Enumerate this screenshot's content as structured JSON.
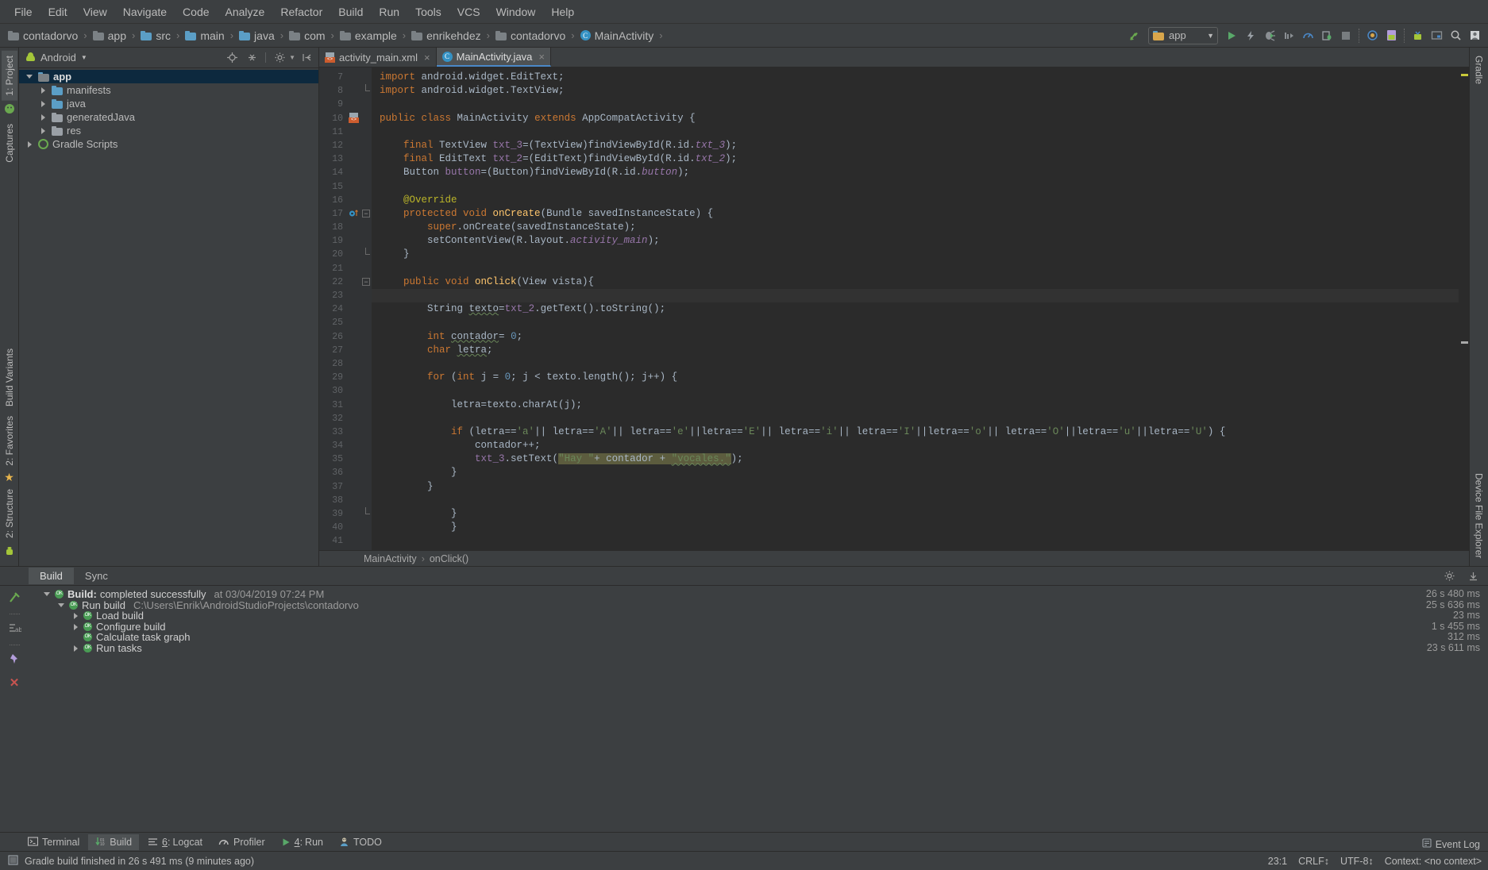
{
  "menubar": {
    "items": [
      "File",
      "Edit",
      "View",
      "Navigate",
      "Code",
      "Analyze",
      "Refactor",
      "Build",
      "Run",
      "Tools",
      "VCS",
      "Window",
      "Help"
    ]
  },
  "navbar": {
    "breadcrumbs": [
      {
        "label": "contadorvo",
        "icon": "project-folder-icon"
      },
      {
        "label": "app",
        "icon": "module-folder-icon"
      },
      {
        "label": "src",
        "icon": "folder-icon"
      },
      {
        "label": "main",
        "icon": "folder-icon"
      },
      {
        "label": "java",
        "icon": "source-folder-icon"
      },
      {
        "label": "com",
        "icon": "package-folder-icon"
      },
      {
        "label": "example",
        "icon": "package-folder-icon"
      },
      {
        "label": "enrikehdez",
        "icon": "package-folder-icon"
      },
      {
        "label": "contadorvo",
        "icon": "package-folder-icon"
      },
      {
        "label": "MainActivity",
        "icon": "java-class-icon"
      }
    ],
    "separator": "›",
    "module_selector": "app",
    "toolbar_icons": [
      "sync-project-icon",
      "run-icon",
      "apply-changes-icon",
      "debug-icon",
      "run-coverage-icon",
      "profiler-icon",
      "attach-debugger-icon",
      "stop-icon",
      "sdk-manager-icon",
      "avd-manager-icon",
      "device-manager-icon",
      "layout-inspector-icon",
      "search-icon",
      "profile-icon"
    ]
  },
  "left_tool_strip": {
    "tabs": [
      "1: Project",
      "Captures"
    ],
    "bottom_tabs": [
      "Build Variants",
      "2: Favorites",
      "2: Structure"
    ]
  },
  "project_panel": {
    "view_selector": "Android",
    "header_icons": [
      "locate-icon",
      "collapse-all-icon",
      "settings-icon",
      "hide-icon"
    ],
    "tree": [
      {
        "label": "app",
        "depth": 0,
        "state": "open",
        "icon": "module-folder-icon",
        "selected": true,
        "bold": true
      },
      {
        "label": "manifests",
        "depth": 1,
        "state": "closed",
        "icon": "folder-icon",
        "selected": false,
        "bold": false
      },
      {
        "label": "java",
        "depth": 1,
        "state": "closed",
        "icon": "folder-icon",
        "selected": false,
        "bold": false
      },
      {
        "label": "generatedJava",
        "depth": 1,
        "state": "closed",
        "icon": "generated-folder-icon",
        "selected": false,
        "bold": false
      },
      {
        "label": "res",
        "depth": 1,
        "state": "closed",
        "icon": "res-folder-icon",
        "selected": false,
        "bold": false
      },
      {
        "label": "Gradle Scripts",
        "depth": 0,
        "state": "closed",
        "icon": "gradle-icon",
        "selected": false,
        "bold": false
      }
    ]
  },
  "editor": {
    "tabs": [
      {
        "label": "activity_main.xml",
        "icon": "xml-layout-icon",
        "active": false
      },
      {
        "label": "MainActivity.java",
        "icon": "java-class-icon",
        "active": true
      }
    ],
    "first_line_number": 7,
    "lines": [
      {
        "n": 7,
        "html": "<span class=\"kw\">import</span><span class=\"pln\"> android.widget.EditText;</span>"
      },
      {
        "n": 8,
        "html": "<span class=\"kw\">import</span><span class=\"pln\"> android.widget.TextView;</span>",
        "fold": "end"
      },
      {
        "n": 9,
        "html": ""
      },
      {
        "n": 10,
        "html": "<span class=\"kw\">public class </span><span class=\"pln\">MainActivity </span><span class=\"kw\">extends </span><span class=\"pln\">AppCompatActivity {</span>",
        "gmark": "xml"
      },
      {
        "n": 11,
        "html": ""
      },
      {
        "n": 12,
        "html": "    <span class=\"kw\">final </span><span class=\"pln\">TextView </span><span class=\"fld\">txt_3</span><span class=\"pln\">=(TextView)findViewById(R.id.</span><span class=\"sfld\">txt_3</span><span class=\"pln\">);</span>"
      },
      {
        "n": 13,
        "html": "    <span class=\"kw\">final </span><span class=\"pln\">EditText </span><span class=\"fld\">txt_2</span><span class=\"pln\">=(EditText)findViewById(R.id.</span><span class=\"sfld\">txt_2</span><span class=\"pln\">);</span>"
      },
      {
        "n": 14,
        "html": "    <span class=\"pln\">Button </span><span class=\"fld\">button</span><span class=\"pln\">=(Button)findViewById(R.id.</span><span class=\"sfld\">button</span><span class=\"pln\">);</span>"
      },
      {
        "n": 15,
        "html": ""
      },
      {
        "n": 16,
        "html": "    <span class=\"anno\">@Override</span>"
      },
      {
        "n": 17,
        "html": "    <span class=\"kw\">protected void </span><span class=\"mtd\">onCreate</span><span class=\"pln\">(Bundle savedInstanceState) {</span>",
        "gmark": "override",
        "fold": "start"
      },
      {
        "n": 18,
        "html": "        <span class=\"kw\">super</span><span class=\"pln\">.onCreate(savedInstanceState);</span>"
      },
      {
        "n": 19,
        "html": "        <span class=\"pln\">setContentView(R.layout.</span><span class=\"sfld\">activity_main</span><span class=\"pln\">);</span>"
      },
      {
        "n": 20,
        "html": "    <span class=\"pln\">}</span>",
        "fold": "end"
      },
      {
        "n": 21,
        "html": ""
      },
      {
        "n": 22,
        "html": "    <span class=\"kw\">public void </span><span class=\"mtd\">onClick</span><span class=\"pln\">(View vista){</span>",
        "fold": "start"
      },
      {
        "n": 23,
        "html": "",
        "caret": true
      },
      {
        "n": 24,
        "html": "        <span class=\"pln\">String </span><span class=\"pln ident-warn\">texto</span><span class=\"pln\">=</span><span class=\"fld\">txt_2</span><span class=\"pln\">.getText().toString();</span>"
      },
      {
        "n": 25,
        "html": ""
      },
      {
        "n": 26,
        "html": "        <span class=\"kw\">int </span><span class=\"pln ident-warn\">contador</span><span class=\"pln\">= </span><span class=\"num\">0</span><span class=\"pln\">;</span>"
      },
      {
        "n": 27,
        "html": "        <span class=\"kw\">char </span><span class=\"pln ident-warn\">letra</span><span class=\"pln\">;</span>"
      },
      {
        "n": 28,
        "html": ""
      },
      {
        "n": 29,
        "html": "        <span class=\"kw\">for </span><span class=\"pln\">(</span><span class=\"kw\">int </span><span class=\"pln\">j = </span><span class=\"num\">0</span><span class=\"pln\">; j &lt; texto.length(); j++) {</span>"
      },
      {
        "n": 30,
        "html": ""
      },
      {
        "n": 31,
        "html": "            <span class=\"pln\">letra=texto.charAt(j);</span>"
      },
      {
        "n": 32,
        "html": ""
      },
      {
        "n": 33,
        "html": "            <span class=\"kw\">if </span><span class=\"pln\">(letra==</span><span class=\"str\">'a'</span><span class=\"pln\">|| letra==</span><span class=\"str\">'A'</span><span class=\"pln\">|| letra==</span><span class=\"str\">'e'</span><span class=\"pln\">||letra==</span><span class=\"str\">'E'</span><span class=\"pln\">|| letra==</span><span class=\"str\">'i'</span><span class=\"pln\">|| letra==</span><span class=\"str\">'I'</span><span class=\"pln\">||letra==</span><span class=\"str\">'o'</span><span class=\"pln\">|| letra==</span><span class=\"str\">'O'</span><span class=\"pln\">||letra==</span><span class=\"str\">'u'</span><span class=\"pln\">||letra==</span><span class=\"str\">'U'</span><span class=\"pln\">) {</span>"
      },
      {
        "n": 34,
        "html": "                <span class=\"pln\">contador++;</span>"
      },
      {
        "n": 35,
        "html": "                <span class=\"fld\">txt_3</span><span class=\"pln\">.setText(</span><span class=\"hl-sel\"><span class=\"str\">\"Hay \"</span><span class=\"pln\">+ contador + </span><span class=\"str ident-warn\">\"vocales.\"</span></span><span class=\"pln\">);</span>"
      },
      {
        "n": 36,
        "html": "            <span class=\"pln\">}</span>"
      },
      {
        "n": 37,
        "html": "        <span class=\"pln\">}</span>"
      },
      {
        "n": 38,
        "html": ""
      },
      {
        "n": 39,
        "html": "            <span class=\"pln\">}</span>",
        "fold": "end"
      },
      {
        "n": 40,
        "html": "            <span class=\"pln\">}</span>"
      },
      {
        "n": 41,
        "html": ""
      }
    ],
    "breadcrumb": [
      "MainActivity",
      "onClick()"
    ],
    "breadcrumb_sep": "›"
  },
  "build_window": {
    "tabs": [
      {
        "label": "Build",
        "selected": true
      },
      {
        "label": "Sync",
        "selected": false
      }
    ],
    "rows": [
      {
        "depth": 0,
        "twisty": "open",
        "bold_label": "Build:",
        "label": "completed successfully",
        "extra": "at 03/04/2019 07:24 PM",
        "duration": "26 s 480 ms"
      },
      {
        "depth": 1,
        "twisty": "open",
        "bold_label": "",
        "label": "Run build",
        "extra": "C:\\Users\\Enrik\\AndroidStudioProjects\\contadorvo",
        "duration": "25 s 636 ms"
      },
      {
        "depth": 2,
        "twisty": "closed",
        "bold_label": "",
        "label": "Load build",
        "extra": "",
        "duration": "23 ms"
      },
      {
        "depth": 2,
        "twisty": "closed",
        "bold_label": "",
        "label": "Configure build",
        "extra": "",
        "duration": "1 s 455 ms"
      },
      {
        "depth": 2,
        "twisty": "none",
        "bold_label": "",
        "label": "Calculate task graph",
        "extra": "",
        "duration": "312 ms"
      },
      {
        "depth": 2,
        "twisty": "closed",
        "bold_label": "",
        "label": "Run tasks",
        "extra": "",
        "duration": "23 s 611 ms"
      }
    ],
    "side_icons": [
      "build-hammer-icon",
      "toggle-tasks-icon",
      "pin-icon",
      "close-icon"
    ],
    "header_icons": [
      "settings-icon",
      "hide-icon"
    ]
  },
  "bottom_toolwindows": [
    {
      "label": "Terminal",
      "icon": "terminal-icon",
      "selected": false,
      "mnemonic": ""
    },
    {
      "label": "Build",
      "icon": "build-icon",
      "selected": true,
      "mnemonic": ""
    },
    {
      "label": "Logcat",
      "icon": "logcat-icon",
      "selected": false,
      "mnemonic": "6"
    },
    {
      "label": "Profiler",
      "icon": "profiler-icon",
      "selected": false,
      "mnemonic": ""
    },
    {
      "label": "Run",
      "icon": "run-icon",
      "selected": false,
      "mnemonic": "4"
    },
    {
      "label": "TODO",
      "icon": "todo-icon",
      "selected": false,
      "mnemonic": ""
    }
  ],
  "right_tool_strip": {
    "top_tabs": [
      "Gradle"
    ],
    "bottom_tabs": [
      "Device File Explorer"
    ]
  },
  "statusbar": {
    "message": "Gradle build finished in 26 s 491 ms (9 minutes ago)",
    "caret_position": "23:1",
    "line_separator": "CRLF↕",
    "encoding": "UTF-8↕",
    "context": "Context: <no context>",
    "event_log": "Event Log"
  },
  "colors": {
    "accent_blue": "#4a88c7",
    "selection_blue": "#0d293e",
    "green_ok": "#499c54",
    "panel_bg": "#3c3f41",
    "editor_bg": "#2b2b2b",
    "gutter_bg": "#313335",
    "string_green": "#6a8759",
    "keyword_orange": "#cc7832",
    "highlight_olive": "#5c5c3e"
  }
}
